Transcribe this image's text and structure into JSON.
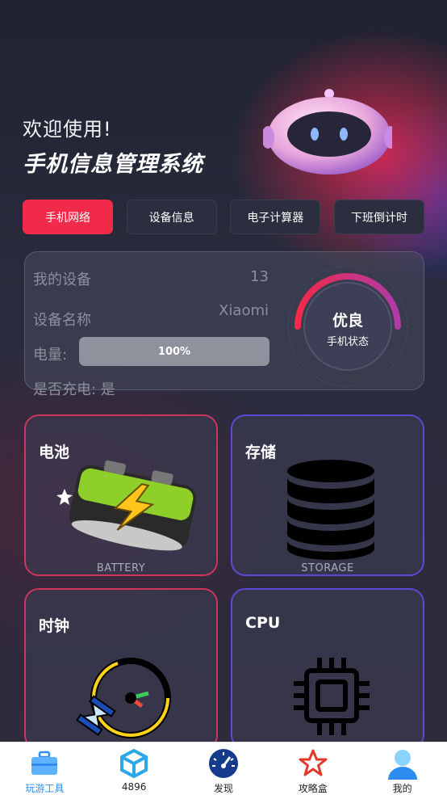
{
  "header": {
    "welcome": "欢迎使用!",
    "title": "手机信息管理系统"
  },
  "tabs": [
    {
      "label": "手机网络",
      "active": true
    },
    {
      "label": "设备信息",
      "active": false
    },
    {
      "label": "电子计算器",
      "active": false
    },
    {
      "label": "下班倒计时",
      "active": false
    }
  ],
  "device": {
    "my_device_label": "我的设备",
    "my_device_value": "13",
    "name_label": "设备名称",
    "name_value": "Xiaomi",
    "battery_label": "电量:",
    "battery_value": "100%",
    "battery_level": 1.0,
    "charging_text": "是否充电: 是"
  },
  "status": {
    "title": "优良",
    "subtitle": "手机状态"
  },
  "tiles": [
    {
      "title": "电池",
      "subtitle": "BATTERY",
      "icon": "battery-icon"
    },
    {
      "title": "存储",
      "subtitle": "STORAGE",
      "icon": "database-icon"
    },
    {
      "title": "时钟",
      "subtitle": "",
      "icon": "clock-icon"
    },
    {
      "title": "CPU",
      "subtitle": "",
      "icon": "cpu-icon"
    }
  ],
  "tabbar": [
    {
      "label": "玩游工具",
      "icon": "toolbox-icon",
      "active": true
    },
    {
      "label": "4896",
      "icon": "cube-icon",
      "active": false
    },
    {
      "label": "发现",
      "icon": "speedometer-icon",
      "active": false
    },
    {
      "label": "攻略盒",
      "icon": "star-icon",
      "active": false
    },
    {
      "label": "我的",
      "icon": "user-icon",
      "active": false
    }
  ],
  "colors": {
    "accent": "#f12a4a",
    "tab_active_text": "#2d8cf0",
    "background": "#272938"
  }
}
